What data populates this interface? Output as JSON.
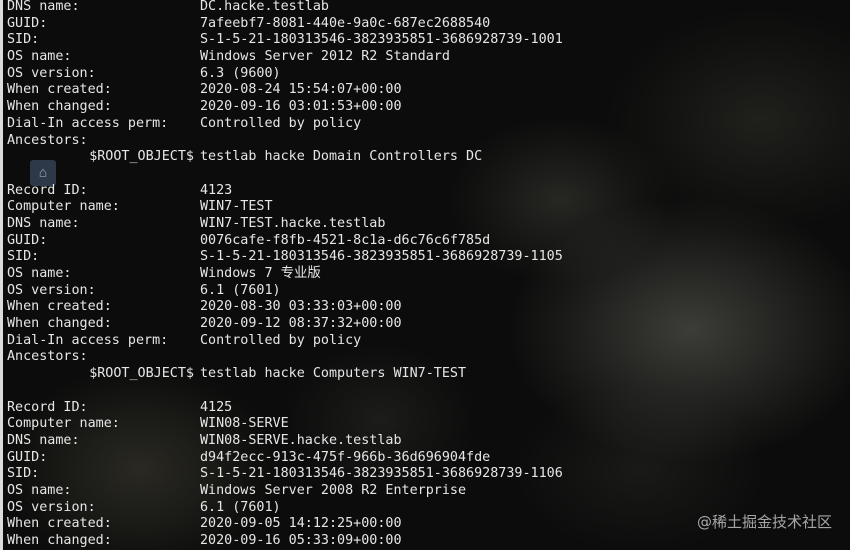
{
  "records": [
    {
      "fields": [
        {
          "key": "DNS name:",
          "value": "DC.hacke.testlab"
        },
        {
          "key": "GUID:",
          "value": "7afeebf7-8081-440e-9a0c-687ec2688540"
        },
        {
          "key": "SID:",
          "value": "S-1-5-21-180313546-3823935851-3686928739-1001"
        },
        {
          "key": "OS name:",
          "value": "Windows Server 2012 R2 Standard"
        },
        {
          "key": "OS version:",
          "value": "6.3 (9600)"
        },
        {
          "key": "When created:",
          "value": "2020-08-24 15:54:07+00:00"
        },
        {
          "key": "When changed:",
          "value": "2020-09-16 03:01:53+00:00"
        },
        {
          "key": "Dial-In access perm:",
          "value": "Controlled by policy"
        },
        {
          "key": "Ancestors:",
          "value": ""
        }
      ],
      "ancestors": {
        "prefix": "$ROOT_OBJECT$",
        "path": "testlab hacke Domain Controllers DC"
      }
    },
    {
      "fields": [
        {
          "key": "Record ID:",
          "value": "4123"
        },
        {
          "key": "Computer name:",
          "value": "WIN7-TEST"
        },
        {
          "key": "DNS name:",
          "value": "WIN7-TEST.hacke.testlab"
        },
        {
          "key": "GUID:",
          "value": "0076cafe-f8fb-4521-8c1a-d6c76c6f785d"
        },
        {
          "key": "SID:",
          "value": "S-1-5-21-180313546-3823935851-3686928739-1105"
        },
        {
          "key": "OS name:",
          "value": "Windows 7 专业版"
        },
        {
          "key": "OS version:",
          "value": "6.1 (7601)"
        },
        {
          "key": "When created:",
          "value": "2020-08-30 03:33:03+00:00"
        },
        {
          "key": "When changed:",
          "value": "2020-09-12 08:37:32+00:00"
        },
        {
          "key": "Dial-In access perm:",
          "value": "Controlled by policy"
        },
        {
          "key": "Ancestors:",
          "value": ""
        }
      ],
      "ancestors": {
        "prefix": "$ROOT_OBJECT$",
        "path": "testlab hacke Computers WIN7-TEST"
      }
    },
    {
      "fields": [
        {
          "key": "Record ID:",
          "value": "4125"
        },
        {
          "key": "Computer name:",
          "value": "WIN08-SERVE"
        },
        {
          "key": "DNS name:",
          "value": "WIN08-SERVE.hacke.testlab"
        },
        {
          "key": "GUID:",
          "value": "d94f2ecc-913c-475f-966b-36d696904fde"
        },
        {
          "key": "SID:",
          "value": "S-1-5-21-180313546-3823935851-3686928739-1106"
        },
        {
          "key": "OS name:",
          "value": "Windows Server 2008 R2 Enterprise"
        },
        {
          "key": "OS version:",
          "value": "6.1 (7601)"
        },
        {
          "key": "When created:",
          "value": "2020-09-05 14:12:25+00:00"
        },
        {
          "key": "When changed:",
          "value": "2020-09-16 05:33:09+00:00"
        }
      ]
    }
  ],
  "watermark": "@稀土掘金技术社区",
  "colors": {
    "text": "#e6e6e6",
    "background": "#0b0c0b"
  }
}
